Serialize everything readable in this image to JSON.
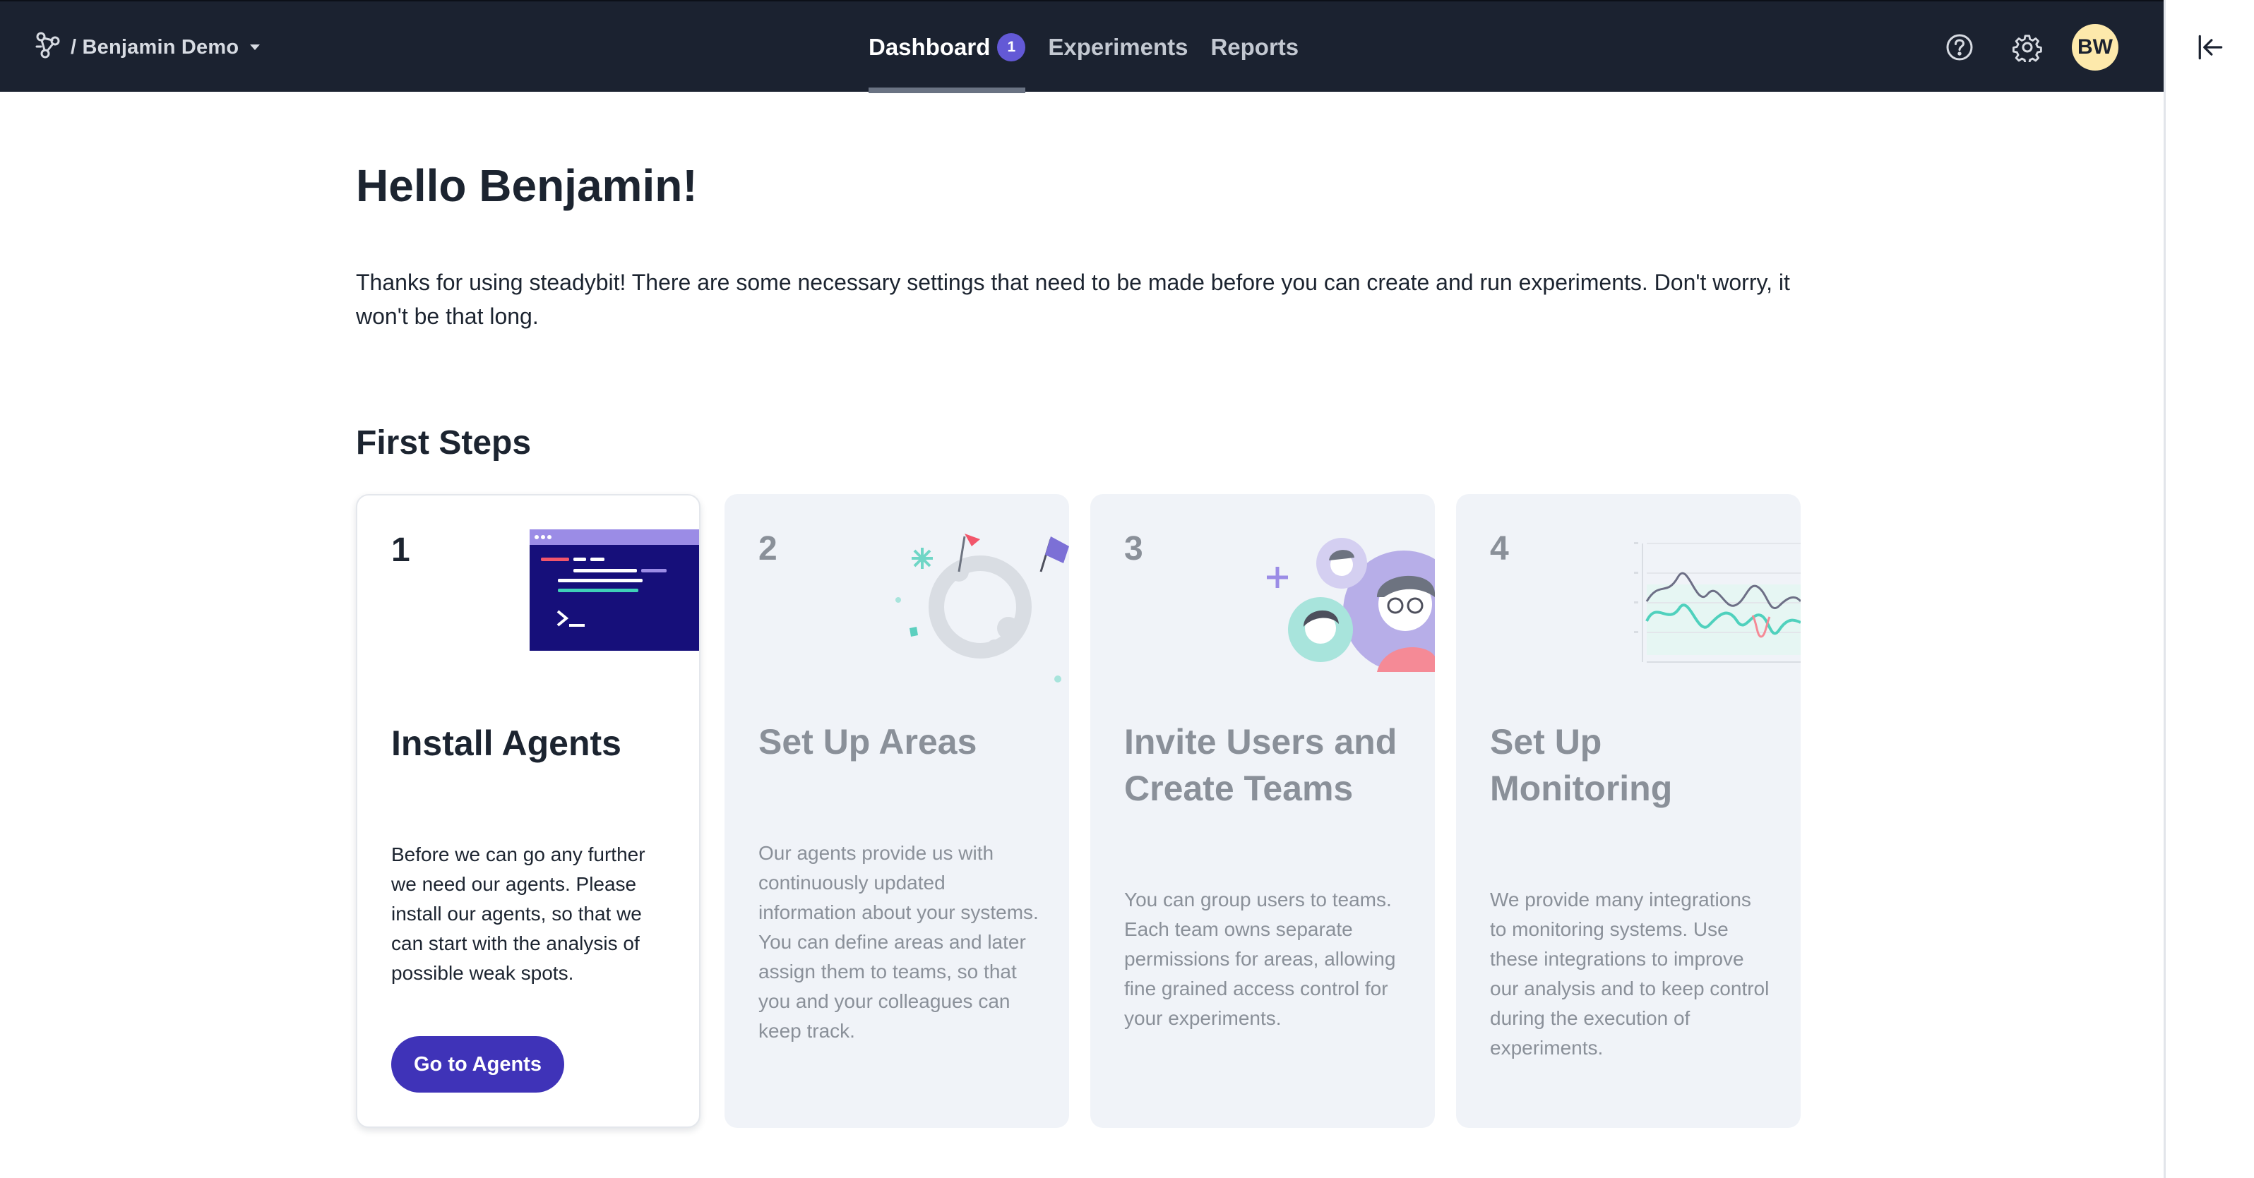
{
  "topbar": {
    "workspace": "/ Benjamin Demo",
    "nav": [
      {
        "label": "Dashboard",
        "badge": "1",
        "active": true
      },
      {
        "label": "Experiments",
        "active": false
      },
      {
        "label": "Reports",
        "active": false
      }
    ],
    "avatar_initials": "BW",
    "icons": [
      "brand-logo-icon",
      "help-icon",
      "gear-icon",
      "collapse-panel-icon"
    ]
  },
  "main": {
    "greeting": "Hello Benjamin!",
    "intro": "Thanks for using steadybit! There are some necessary settings that need to be made before you can create and run experiments. Don't worry, it won't be that long.",
    "section_title": "First Steps",
    "cards": [
      {
        "number": "1",
        "title": "Install Agents",
        "text": "Before we can go any further we need our agents. Please install our agents, so that we can start with the analysis of possible weak spots.",
        "button": "Go to Agents"
      },
      {
        "number": "2",
        "title": "Set Up Areas",
        "text": "Our agents provide us with continuously updated information about your systems. You can define areas and later assign them to teams, so that you and your colleagues can keep track."
      },
      {
        "number": "3",
        "title": "Invite Users and Create Teams",
        "text": "You can group users to teams. Each team owns separate permissions for areas, allowing fine grained access control for your experiments."
      },
      {
        "number": "4",
        "title": "Set Up Monitoring",
        "text": "We provide many integrations to monitoring systems. Use these integrations to improve our analysis and to keep control during the execution of experiments."
      }
    ]
  },
  "colors": {
    "topbar_bg": "#1b2230",
    "accent": "#3f33b8",
    "badge": "#6359d6",
    "avatar_bg": "#fde9ab",
    "card_bg": "#f0f3f8"
  }
}
